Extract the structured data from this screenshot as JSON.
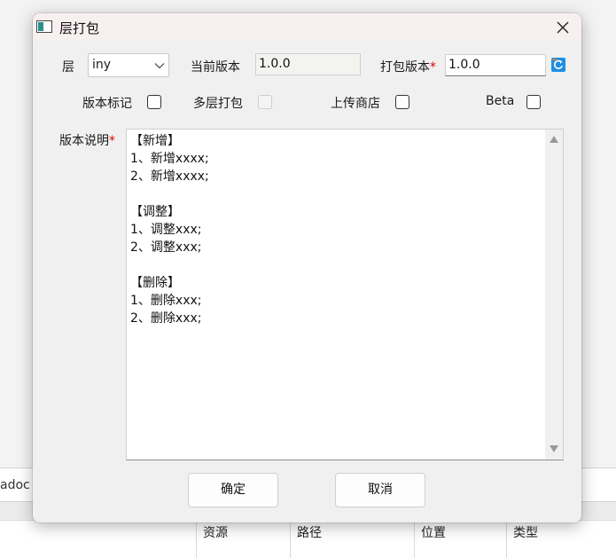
{
  "background": {
    "band_text": "adoc",
    "columns": [
      "资源",
      "路径",
      "位置",
      "类型"
    ]
  },
  "dialog": {
    "title": "层打包",
    "layer_label": "层",
    "layer_value": "iny",
    "current_version_label": "当前版本",
    "current_version_value": "1.0.0",
    "pack_version_label": "打包版本",
    "pack_version_value": "1.0.0",
    "required_mark": "*",
    "version_mark_label": "版本标记",
    "multi_layer_label": "多层打包",
    "upload_store_label": "上传商店",
    "beta_label": "Beta",
    "notes_label": "版本说明",
    "notes_lines": [
      "【新增】",
      "1、新增xxxx;",
      "2、新增xxxx;",
      "",
      "【调整】",
      "1、调整xxx;",
      "2、调整xxx;",
      "",
      "【删除】",
      "1、删除xxx;",
      "2、删除xxx;"
    ],
    "ok_label": "确定",
    "cancel_label": "取消"
  },
  "colors": {
    "titlebar": "#f8eff0",
    "dialog_bg": "#f0f0f0",
    "required": "#e00000",
    "refresh_icon": "#1e8fe0"
  },
  "icons": [
    "app-icon",
    "close-icon",
    "chevron-down-icon",
    "refresh-icon",
    "scroll-up-arrow-icon",
    "scroll-down-arrow-icon"
  ]
}
